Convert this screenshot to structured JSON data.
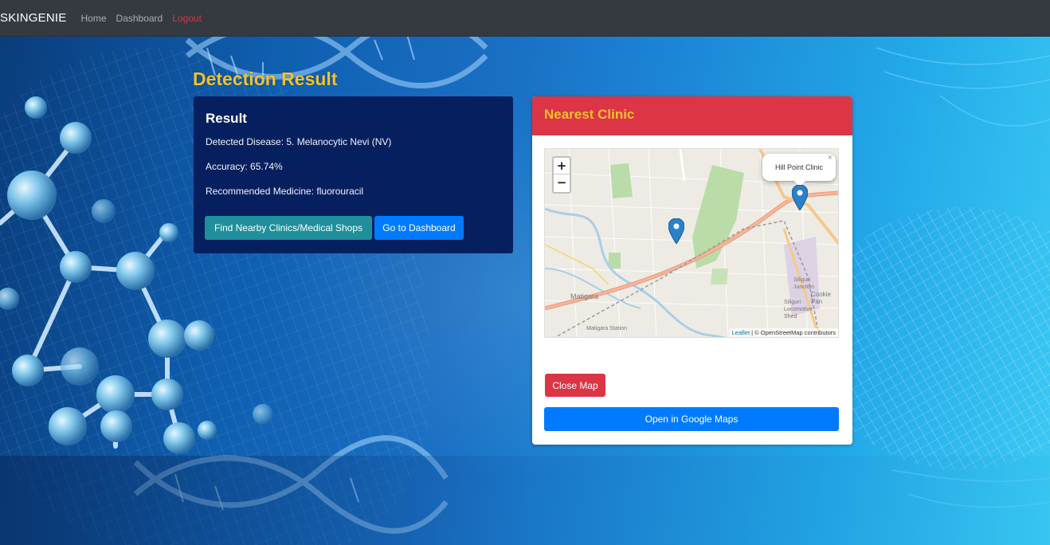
{
  "navbar": {
    "brand": "SKINGENIE",
    "links": [
      {
        "label": "Home"
      },
      {
        "label": "Dashboard"
      },
      {
        "label": "Logout"
      }
    ]
  },
  "page_title": "Detection Result",
  "result": {
    "heading": "Result",
    "detected_disease": "Detected Disease: 5. Melanocytic Nevi (NV)",
    "accuracy": "Accuracy: 65.74%",
    "medicine": "Recommended Medicine: fluorouracil",
    "find_button": "Find Nearby Clinics/Medical Shops",
    "dashboard_button": "Go to Dashboard"
  },
  "clinic": {
    "heading": "Nearest Clinic",
    "map": {
      "zoom_in": "+",
      "zoom_out": "−",
      "popup_text": "Hill Point Clinic",
      "popup_close": "×",
      "place_label_1": "Matigara",
      "place_label_2": "Matigara Station",
      "place_label_3": "Siliguri Junction",
      "place_label_4": "Siliguri Locomotive Shed",
      "place_label_5": "Cookie Pan",
      "attribution_leaflet": "Leaflet",
      "attribution_rest": " | © OpenStreetMap contributors"
    },
    "close_button": "Close Map",
    "gmaps_button": "Open in Google Maps"
  },
  "colors": {
    "navbar": "#343a40",
    "title": "#f2c12e",
    "result_card": "#06205f",
    "clinic_header": "#dc3545",
    "primary": "#007bff",
    "teal": "#1f8f9b",
    "marker": "#2a81cb"
  }
}
